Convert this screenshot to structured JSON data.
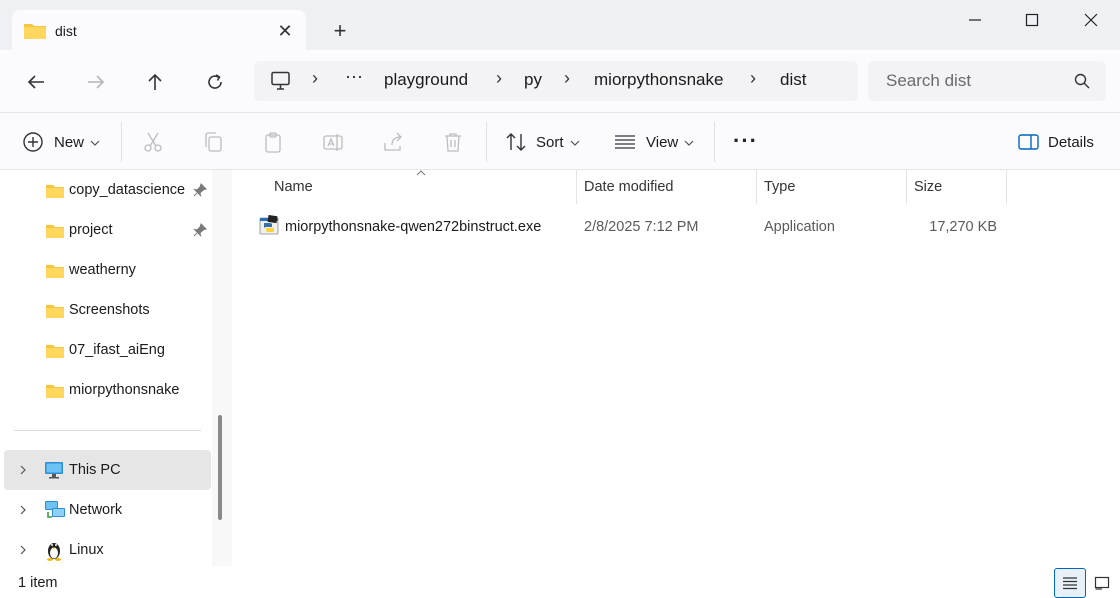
{
  "tab": {
    "title": "dist"
  },
  "breadcrumb": {
    "ellipsis": "···",
    "items": [
      "playground",
      "py",
      "miorpythonsnake",
      "dist"
    ]
  },
  "search": {
    "placeholder": "Search dist"
  },
  "toolbar": {
    "new_label": "New",
    "sort_label": "Sort",
    "view_label": "View",
    "more_label": "···",
    "details_label": "Details"
  },
  "sidebar": {
    "pinned": [
      {
        "label": "copy_datascience",
        "pinned": true
      },
      {
        "label": "project",
        "pinned": true
      },
      {
        "label": "weatherny",
        "pinned": false
      },
      {
        "label": "Screenshots",
        "pinned": false
      },
      {
        "label": "07_ifast_aiEng",
        "pinned": false
      },
      {
        "label": "miorpythonsnake",
        "pinned": false
      }
    ],
    "locations": [
      {
        "label": "This PC",
        "icon": "monitor-icon",
        "selected": true
      },
      {
        "label": "Network",
        "icon": "network-icon",
        "selected": false
      },
      {
        "label": "Linux",
        "icon": "linux-penguin-icon",
        "selected": false
      }
    ]
  },
  "columns": {
    "name": "Name",
    "date": "Date modified",
    "type": "Type",
    "size": "Size"
  },
  "files": [
    {
      "name": "miorpythonsnake-qwen272binstruct.exe",
      "date": "2/8/2025 7:12 PM",
      "type": "Application",
      "size": "17,270 KB",
      "icon": "python-exe-icon"
    }
  ],
  "status": {
    "count": "1 item"
  },
  "colors": {
    "accent": "#0067c0",
    "folder": "#f4c542",
    "selection": "#e6e6e6"
  }
}
